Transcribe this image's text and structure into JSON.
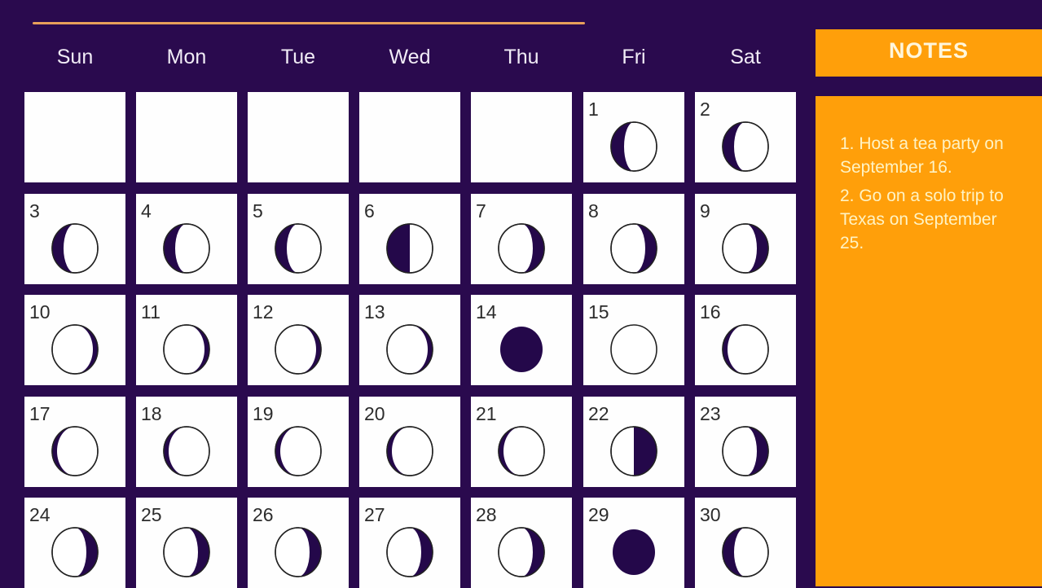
{
  "calendar": {
    "weekdays": [
      "Sun",
      "Mon",
      "Tue",
      "Wed",
      "Thu",
      "Fri",
      "Sat"
    ],
    "first_weekday_index": 5,
    "days_in_month": 30,
    "moon_phases": {
      "1": "waxing-crescent-left-dark-large",
      "2": "crescent-left-dark",
      "3": "crescent-left-dark",
      "4": "crescent-left-dark",
      "5": "crescent-left-dark",
      "6": "half-left-dark",
      "7": "crescent-right-dark",
      "8": "crescent-right-dark",
      "9": "crescent-right-dark",
      "10": "thin-right-dark",
      "11": "thin-right-dark",
      "12": "thin-right-dark",
      "13": "thin-right-dark",
      "14": "new-moon",
      "15": "full-moon",
      "16": "thin-left-dark",
      "17": "thin-left-dark",
      "18": "thin-left-dark",
      "19": "thin-left-dark",
      "20": "thin-left-dark",
      "21": "thin-left-dark",
      "22": "half-right-dark",
      "23": "crescent-right-dark",
      "24": "crescent-right-dark",
      "25": "crescent-right-dark",
      "26": "crescent-right-dark",
      "27": "crescent-right-dark",
      "28": "crescent-right-dark",
      "29": "new-moon",
      "30": "crescent-left-dark"
    }
  },
  "notes": {
    "title": "NOTES",
    "items": [
      "1. Host a tea party on September 16.",
      "2. Go on a solo trip to Texas on September 25."
    ]
  },
  "colors": {
    "background": "#2a0a4e",
    "accent_orange": "#ff9f0a",
    "moon_dark": "#24084a",
    "rule": "#e8a05a"
  }
}
